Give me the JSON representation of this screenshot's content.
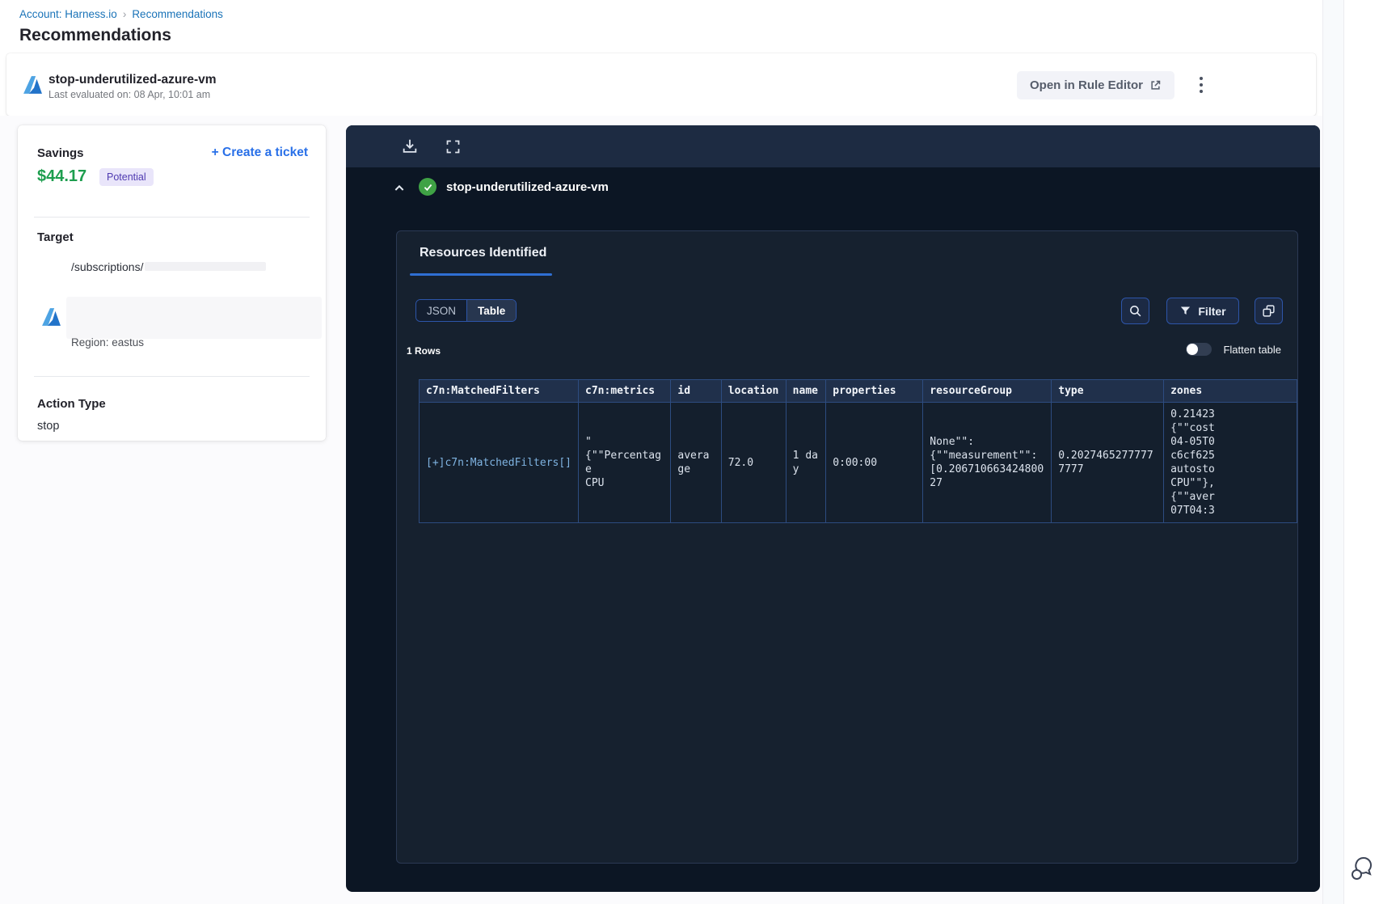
{
  "breadcrumb": {
    "account": "Account: Harness.io",
    "separator": "›",
    "current": "Recommendations"
  },
  "page_title": "Recommendations",
  "header": {
    "title": "stop-underutilized-azure-vm",
    "subtitle": "Last evaluated on: 08 Apr, 10:01 am",
    "open_rule_editor_label": "Open in Rule Editor"
  },
  "savings_card": {
    "savings_label": "Savings",
    "create_ticket_label": "+ Create a ticket",
    "amount": "$44.17",
    "badge": "Potential",
    "target_label": "Target",
    "target_path": "/subscriptions/",
    "region": "Region: eastus",
    "action_type_label": "Action Type",
    "action_type_value": "stop"
  },
  "panel": {
    "title": "stop-underutilized-azure-vm",
    "tab_label": "Resources Identified",
    "view_toggle": {
      "json_label": "JSON",
      "table_label": "Table",
      "selected": "Table"
    },
    "filter_label": "Filter",
    "rows_count": "1 Rows",
    "flatten_label": "Flatten table",
    "flatten_enabled": false,
    "table": {
      "columns": [
        "c7n:MatchedFilters",
        "c7n:metrics",
        "id",
        "location",
        "name",
        "properties",
        "resourceGroup",
        "type",
        "zones"
      ],
      "rows": [
        [
          "[+]c7n:MatchedFilters[]",
          "\"\n{\"\"Percentage\nCPU",
          "average",
          "72.0",
          "1 day",
          "0:00:00",
          "None\"\":\n{\"\"measurement\"\":\n[0.20671066342480027",
          "0.20274652777777777",
          "0.21423\n{\"\"cost\n04-05T0\nc6cf625\nautosto\nCPU\"\"},\n{\"\"aver\n07T04:3"
        ]
      ]
    }
  },
  "icons": {
    "header_logo": "azure-icon",
    "toolbar": [
      "download-icon",
      "fullscreen-icon"
    ],
    "panel_status": "check-circle-icon",
    "actions": [
      "search-icon",
      "filter-funnel-icon",
      "copy-icon"
    ],
    "floating": "chat-feedback-icon"
  },
  "colors": {
    "accent_blue": "#2970e8",
    "breadcrumb_blue": "#1a73b8",
    "savings_green": "#1e9e4f",
    "badge_bg": "#e9e5fa",
    "badge_text": "#4f3ab1",
    "panel_bg": "#0c1624",
    "panel_toolbar_bg": "#1d2b42",
    "table_border_blue": "#2d4c80",
    "tab_underline_blue": "#2f6fd3",
    "link_light_blue": "#7fb3e1",
    "check_green": "#3fa245"
  }
}
